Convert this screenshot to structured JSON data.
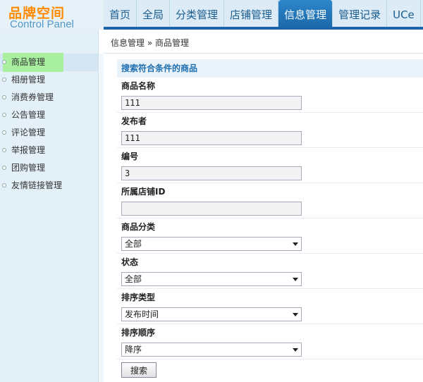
{
  "logo": {
    "title": "品牌空间",
    "subtitle": "Control Panel"
  },
  "nav": {
    "tabs": [
      {
        "label": "首页"
      },
      {
        "label": "全局"
      },
      {
        "label": "分类管理"
      },
      {
        "label": "店铺管理"
      },
      {
        "label": "信息管理"
      },
      {
        "label": "管理记录"
      },
      {
        "label": "UCe"
      }
    ],
    "active": "信息管理"
  },
  "breadcrumb": "信息管理 » 商品管理",
  "sidebar": {
    "items": [
      {
        "label": "商品管理"
      },
      {
        "label": "相册管理"
      },
      {
        "label": "消费券管理"
      },
      {
        "label": "公告管理"
      },
      {
        "label": "评论管理"
      },
      {
        "label": "举报管理"
      },
      {
        "label": "团购管理"
      },
      {
        "label": "友情链接管理"
      }
    ],
    "active": "商品管理"
  },
  "form": {
    "title": "搜索符合条件的商品",
    "fields": {
      "name": {
        "label": "商品名称",
        "value": "111"
      },
      "publisher": {
        "label": "发布者",
        "value": "111"
      },
      "number": {
        "label": "编号",
        "value": "3"
      },
      "shop_id": {
        "label": "所属店铺ID",
        "value": ""
      },
      "category": {
        "label": "商品分类",
        "value": "全部"
      },
      "status": {
        "label": "状态",
        "value": "全部"
      },
      "sort_type": {
        "label": "排序类型",
        "value": "发布时间"
      },
      "sort_order": {
        "label": "排序顺序",
        "value": "降序"
      }
    },
    "search_label": "搜索"
  },
  "colors": {
    "accent": "#1b66a8",
    "logo": "#ff8a00",
    "active_sidebar_highlight": "#a8f0a0"
  }
}
